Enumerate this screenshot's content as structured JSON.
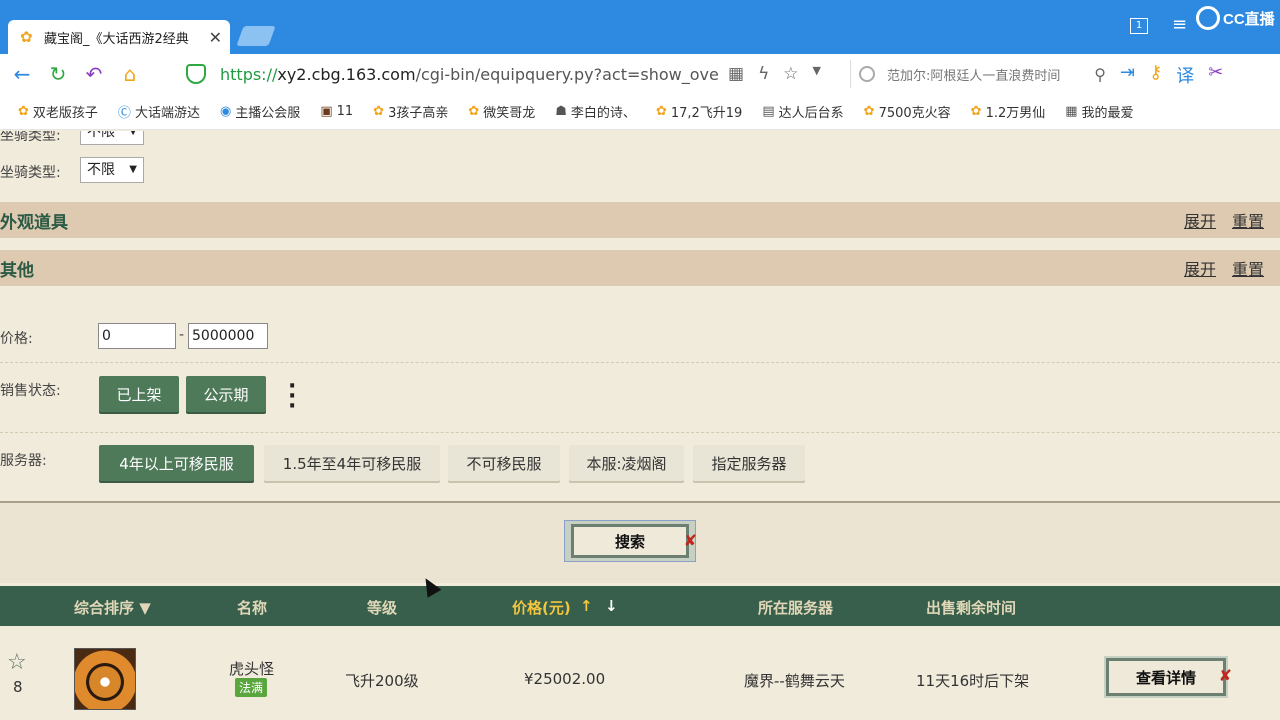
{
  "browser": {
    "tab_title": "藏宝阁_《大话西游2经典",
    "url_scheme": "https://",
    "url_host": "xy2.cbg.163.com",
    "url_path": "/cgi-bin/equipquery.py?act=show_overa",
    "search_placeholder": "范加尔:阿根廷人一直浪费时间",
    "tab_count": "1",
    "brand_logo_text": "CC直播",
    "bookmarks": [
      {
        "label": "双老版孩子",
        "icon": "chick-icon"
      },
      {
        "label": "大话端游达",
        "icon": "c-icon"
      },
      {
        "label": "主播公会服",
        "icon": "bird-icon"
      },
      {
        "label": "11",
        "icon": "game-icon"
      },
      {
        "label": "3孩子高亲",
        "icon": "chick-icon"
      },
      {
        "label": "微笑哥龙",
        "icon": "chick-icon"
      },
      {
        "label": "李白的诗、",
        "icon": "poem-icon"
      },
      {
        "label": "17,2飞升19",
        "icon": "chick-icon"
      },
      {
        "label": "达人后台系",
        "icon": "doc-icon"
      },
      {
        "label": "7500克火容",
        "icon": "chick-icon"
      },
      {
        "label": "1.2万男仙",
        "icon": "chick-icon"
      },
      {
        "label": "我的最爱",
        "icon": "grid-icon"
      }
    ]
  },
  "filters": {
    "mount_type_label_1": "坐骑类型:",
    "mount_type_value_1": "不限",
    "mount_type_label_2": "坐骑类型:",
    "mount_type_value_2": "不限",
    "appearance_section": "外观道具",
    "other_section": "其他",
    "expand": "展开",
    "reset": "重置",
    "price_label": "价格:",
    "price_min": "0",
    "price_sep": "-",
    "price_max": "5000000",
    "sale_status_label": "销售状态:",
    "sale_status_options": [
      "已上架",
      "公示期"
    ],
    "server_label": "服务器:",
    "server_options": [
      "4年以上可移民服",
      "1.5年至4年可移民服",
      "不可移民服",
      "本服:凌烟阁",
      "指定服务器"
    ],
    "search_button": "搜索"
  },
  "table": {
    "headers": {
      "sort": "综合排序 ▼",
      "name": "名称",
      "level": "等级",
      "price": "价格(元)",
      "server": "所在服务器",
      "time_left": "出售剩余时间"
    },
    "row": {
      "fav_count": "8",
      "name": "虎头怪",
      "tag": "法满",
      "level": "飞升200级",
      "price": "¥25002.00",
      "server": "魔界--鹤舞云天",
      "time_left": "11天16时后下架",
      "detail_button": "查看详情"
    }
  },
  "colors": {
    "tabbar": "#2d8ae0",
    "page_bg": "#f1ebdc",
    "section_bg": "#decab0",
    "header_bg": "#375f4b",
    "sorted_header": "#f2c63e",
    "active_filter": "#4f7a5a"
  }
}
